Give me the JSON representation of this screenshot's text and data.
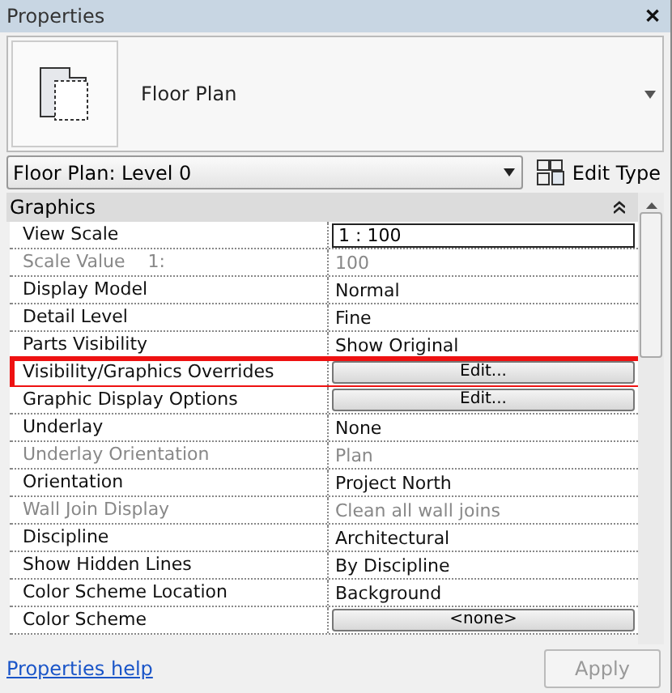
{
  "window": {
    "title": "Properties",
    "close": "✕"
  },
  "type_selector": {
    "name": "Floor Plan"
  },
  "instance": {
    "value": "Floor Plan: Level 0",
    "edit_type": "Edit Type"
  },
  "section": {
    "title": "Graphics",
    "expanded": true
  },
  "rows": [
    {
      "label": "View Scale",
      "value": "1 : 100",
      "kind": "input",
      "disabled": false,
      "highlighted": false
    },
    {
      "label": "Scale Value    1:",
      "value": "100",
      "kind": "text",
      "disabled": true,
      "highlighted": false
    },
    {
      "label": "Display Model",
      "value": "Normal",
      "kind": "text",
      "disabled": false,
      "highlighted": false
    },
    {
      "label": "Detail Level",
      "value": "Fine",
      "kind": "text",
      "disabled": false,
      "highlighted": false
    },
    {
      "label": "Parts Visibility",
      "value": "Show Original",
      "kind": "text",
      "disabled": false,
      "highlighted": false
    },
    {
      "label": "Visibility/Graphics Overrides",
      "value": "Edit...",
      "kind": "button",
      "disabled": false,
      "highlighted": true
    },
    {
      "label": "Graphic Display Options",
      "value": "Edit...",
      "kind": "button",
      "disabled": false,
      "highlighted": false
    },
    {
      "label": "Underlay",
      "value": "None",
      "kind": "text",
      "disabled": false,
      "highlighted": false
    },
    {
      "label": "Underlay Orientation",
      "value": "Plan",
      "kind": "text",
      "disabled": true,
      "highlighted": false
    },
    {
      "label": "Orientation",
      "value": "Project North",
      "kind": "text",
      "disabled": false,
      "highlighted": false
    },
    {
      "label": "Wall Join Display",
      "value": "Clean all wall joins",
      "kind": "text",
      "disabled": true,
      "highlighted": false
    },
    {
      "label": "Discipline",
      "value": "Architectural",
      "kind": "text",
      "disabled": false,
      "highlighted": false
    },
    {
      "label": "Show Hidden Lines",
      "value": "By Discipline",
      "kind": "text",
      "disabled": false,
      "highlighted": false
    },
    {
      "label": "Color Scheme Location",
      "value": "Background",
      "kind": "text",
      "disabled": false,
      "highlighted": false
    },
    {
      "label": "Color Scheme",
      "value": "<none>",
      "kind": "button",
      "disabled": false,
      "highlighted": false
    }
  ],
  "footer": {
    "help_link": "Properties help",
    "apply": {
      "label": "Apply",
      "disabled": true
    }
  }
}
